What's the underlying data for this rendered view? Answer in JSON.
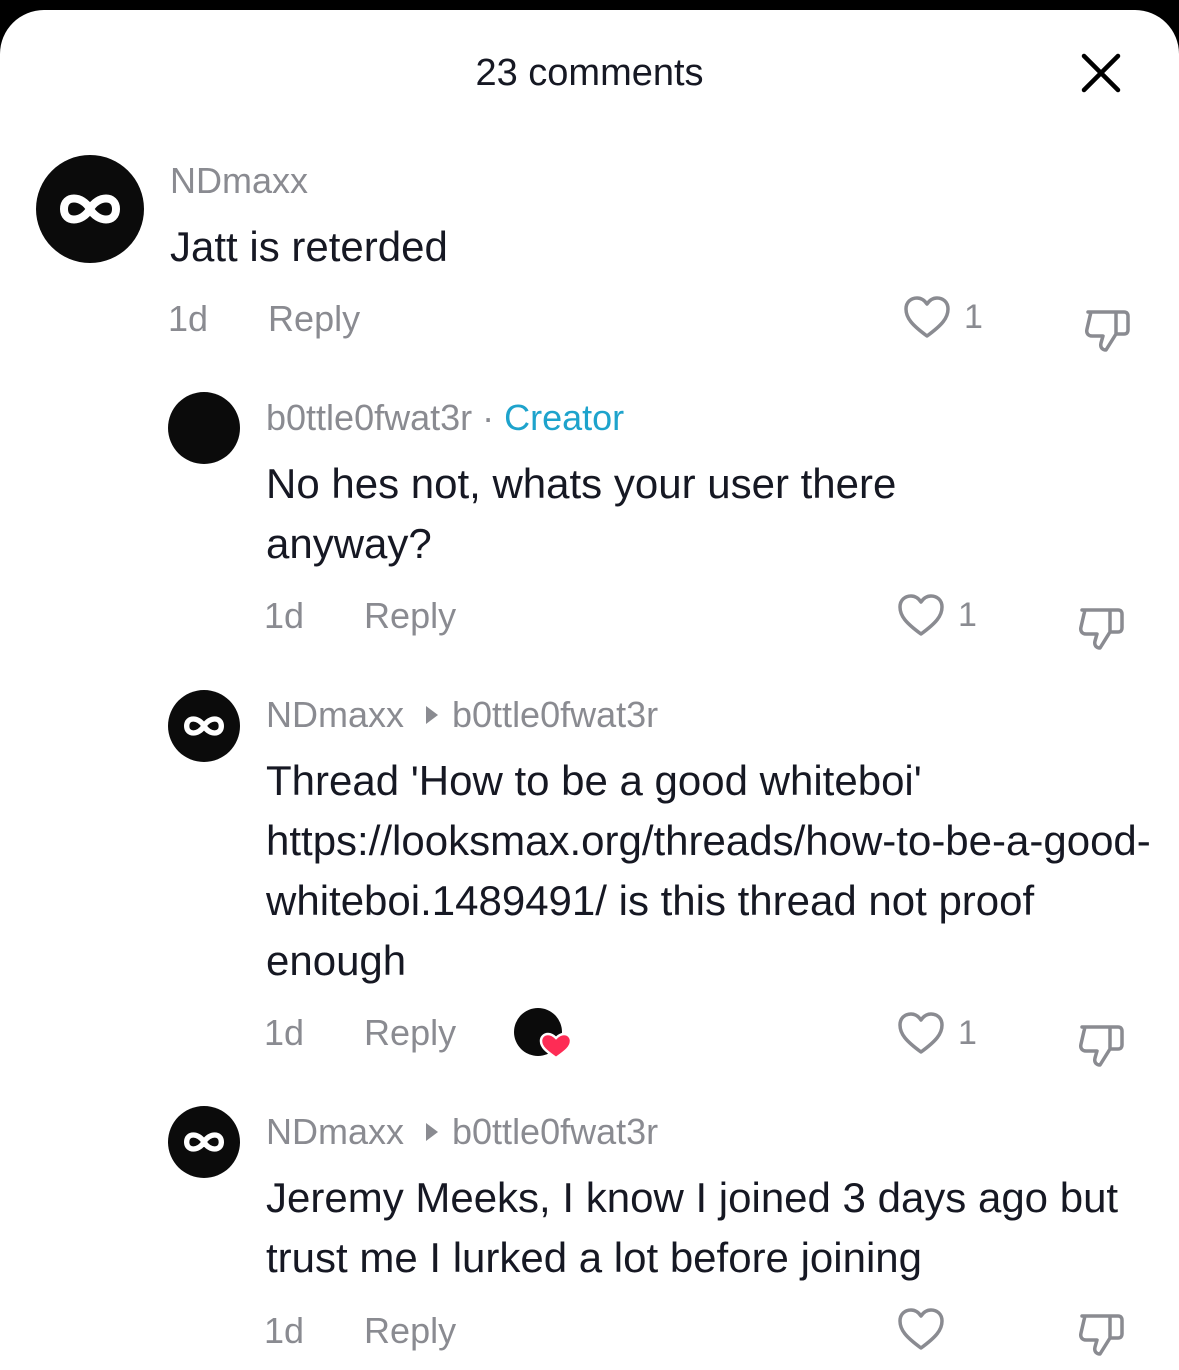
{
  "header": {
    "title": "23 comments"
  },
  "icons": {
    "close": "close-icon",
    "like": "heart-outline-icon",
    "dislike": "thumbs-down-icon",
    "avatar": "infinity-logo-icon",
    "creator_like": "creator-liked-heart-icon"
  },
  "colors": {
    "creator": "#1ea3cc",
    "liked_heart": "#fe2c55",
    "muted": "#8a8b91",
    "text": "#161823"
  },
  "comments": [
    {
      "username": "NDmaxx",
      "text": "Jatt is reterded",
      "time": "1d",
      "reply_label": "Reply",
      "likes": "1"
    },
    {
      "username": "b0ttle0fwat3r",
      "separator": "·",
      "badge": "Creator",
      "text": "No hes not, whats your user there anyway?",
      "time": "1d",
      "reply_label": "Reply",
      "likes": "1"
    },
    {
      "username": "NDmaxx",
      "reply_to": "b0ttle0fwat3r",
      "text": "Thread 'How to be a good whiteboi' https://looksmax.org/threads/how-to-be-a-good-whiteboi.1489491/ is this thread not proof enough",
      "time": "1d",
      "reply_label": "Reply",
      "likes": "1",
      "liked_by_creator": true
    },
    {
      "username": "NDmaxx",
      "reply_to": "b0ttle0fwat3r",
      "text": "Jeremy Meeks, I know I joined 3 days ago but trust me I lurked a lot before joining",
      "time": "1d",
      "reply_label": "Reply",
      "likes": ""
    }
  ]
}
